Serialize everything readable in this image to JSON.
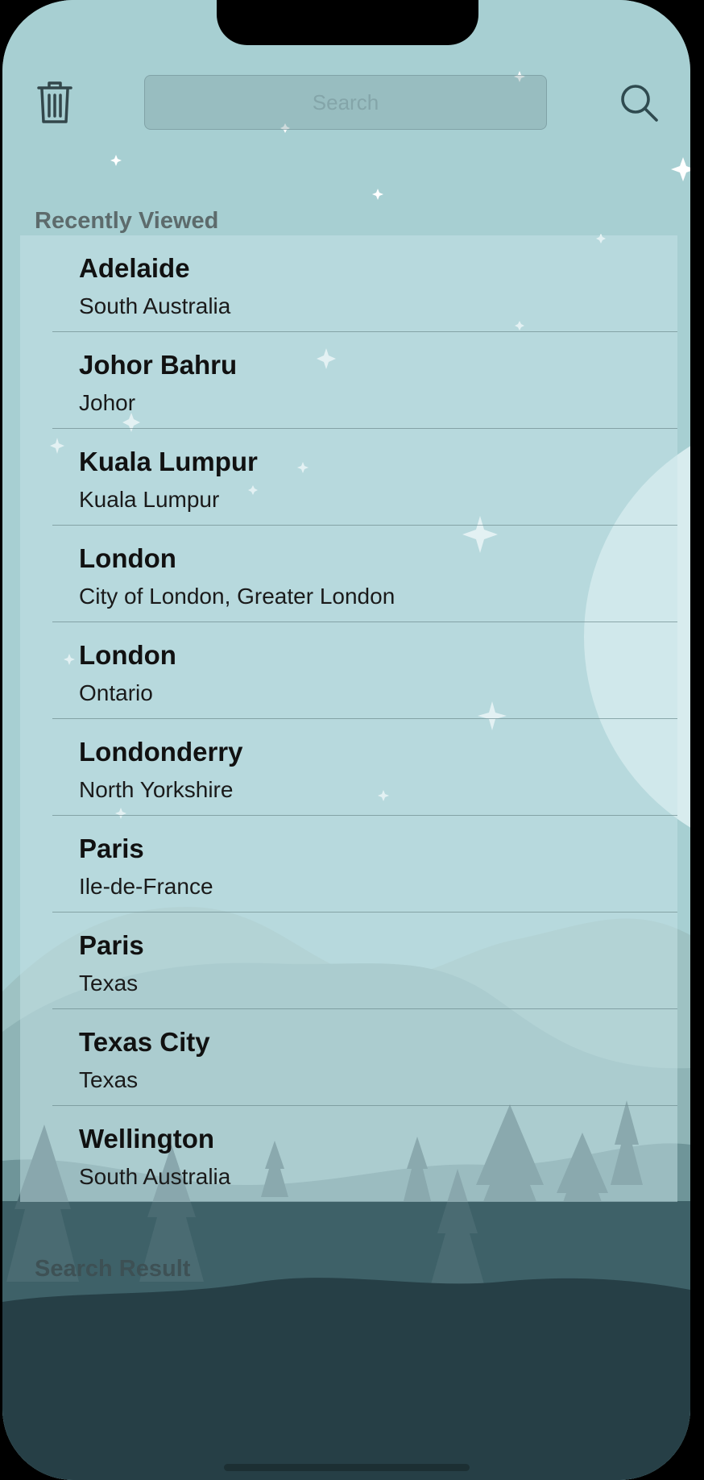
{
  "header": {
    "search_placeholder": "Search",
    "search_value": "",
    "clear_history_icon": "trash-icon",
    "search_icon": "search-icon"
  },
  "recent": {
    "title": "Recently Viewed",
    "items": [
      {
        "city": "Adelaide",
        "region": "South Australia"
      },
      {
        "city": "Johor Bahru",
        "region": "Johor"
      },
      {
        "city": "Kuala Lumpur",
        "region": "Kuala Lumpur"
      },
      {
        "city": "London",
        "region": "City of London, Greater London"
      },
      {
        "city": "London",
        "region": "Ontario"
      },
      {
        "city": "Londonderry",
        "region": "North Yorkshire"
      },
      {
        "city": "Paris",
        "region": "Ile-de-France"
      },
      {
        "city": "Paris",
        "region": "Texas"
      },
      {
        "city": "Texas City",
        "region": "Texas"
      },
      {
        "city": "Wellington",
        "region": "South Australia"
      }
    ]
  },
  "results": {
    "title": "Search Result"
  },
  "colors": {
    "sky": "#a7cfd2",
    "hills_far": "#9cbfc0",
    "forest_mid": "#3f636a",
    "forest_dark": "#27414a",
    "moon": "#d8ecee"
  }
}
